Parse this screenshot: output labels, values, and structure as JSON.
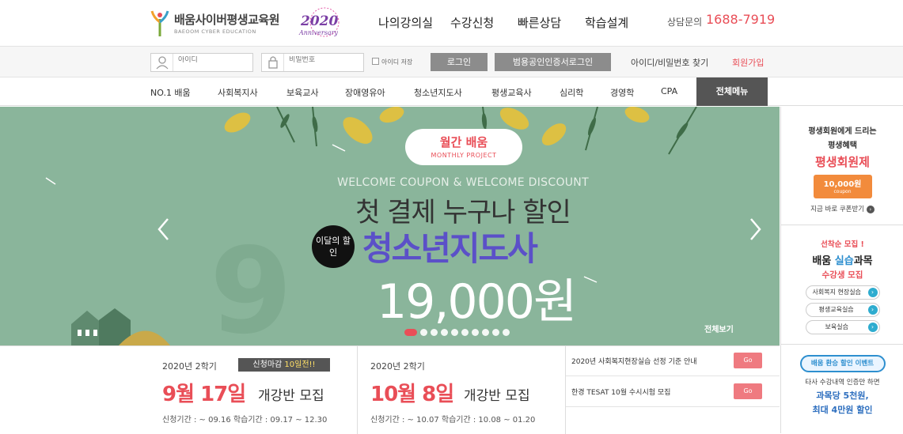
{
  "header": {
    "logo_name": "배움사이버평생교육원",
    "logo_sub": "BAEOOM CYBER EDUCATION",
    "anniv_top": "2020",
    "anniv_bottom": "Anniversary",
    "nav": [
      "나의강의실",
      "수강신청",
      "빠른상담",
      "학습설계"
    ],
    "tel_label": "상담문의",
    "tel_number": "1688-7919"
  },
  "login": {
    "id_placeholder": "아이디",
    "pw_placeholder": "비밀번호",
    "save_id_label": "아이디 저장",
    "login_button": "로그인",
    "cert_login_button": "범용공인인증서로그인",
    "find_link": "아이디/비밀번호 찾기",
    "join_link": "회원가입"
  },
  "categories": [
    "NO.1 배움",
    "사회복지사",
    "보육교사",
    "장애영유아",
    "청소년지도사",
    "평생교육사",
    "심리학",
    "경영학",
    "CPA"
  ],
  "all_menu": "전체메뉴",
  "banner": {
    "pill_title": "월간 배움",
    "pill_sub": "MONTHLY PROJECT",
    "coupon_line": "WELCOME COUPON & WELCOME DISCOUNT",
    "headline": "첫 결제 누구나 할인",
    "badge": "이달의 할인",
    "course": "청소년지도사",
    "price": "19,000원",
    "all_view": "전체보기",
    "slide_count": 10,
    "active_slide": 1,
    "bg_color": "#8ab59b"
  },
  "sidebar": {
    "card1": {
      "line1": "평생회원에게 드리는",
      "line2": "평생혜택",
      "title": "평생회원제",
      "coupon_amount": "10,000원",
      "coupon_word": "coupon",
      "cta": "지금 바로 쿠폰받기"
    },
    "card2": {
      "top": "선착순 모집 !",
      "title_a": "배움 ",
      "title_b": "실습",
      "title_c": "과목",
      "subtitle": "수강생 모집",
      "items": [
        "사회복지 현장실습",
        "평생교육실습",
        "보육실습"
      ]
    },
    "card3": {
      "pill": "배움 환승 할인 이벤트",
      "line1": "타사 수강내역 인증만 하면",
      "line2": "과목당 5천원,",
      "line3": "최대 4만원 할인"
    }
  },
  "semesters": [
    {
      "label": "2020년 2학기",
      "deadline_pre": "신청마감 ",
      "deadline_hl": "10일전!!",
      "date": "9월 17일",
      "suffix": "개강반 모집",
      "period": "신청기간 : ~ 09.16 학습기간 : 09.17 ~ 12.30"
    },
    {
      "label": "2020년 2학기",
      "date": "10월 8일",
      "suffix": "개강반 모집",
      "period": "신청기간 : ~ 10.07 학습기간 : 10.08 ~ 01.20"
    }
  ],
  "notices": [
    {
      "title": "2020년 사회복지현장실습 선정 기준 안내",
      "go": "Go"
    },
    {
      "title": "한경 TESAT 10월 수시시험 모집",
      "go": "Go"
    }
  ],
  "colors": {
    "accent": "#e94e57",
    "banner": "#8ab59b",
    "course": "#5b50c8"
  }
}
